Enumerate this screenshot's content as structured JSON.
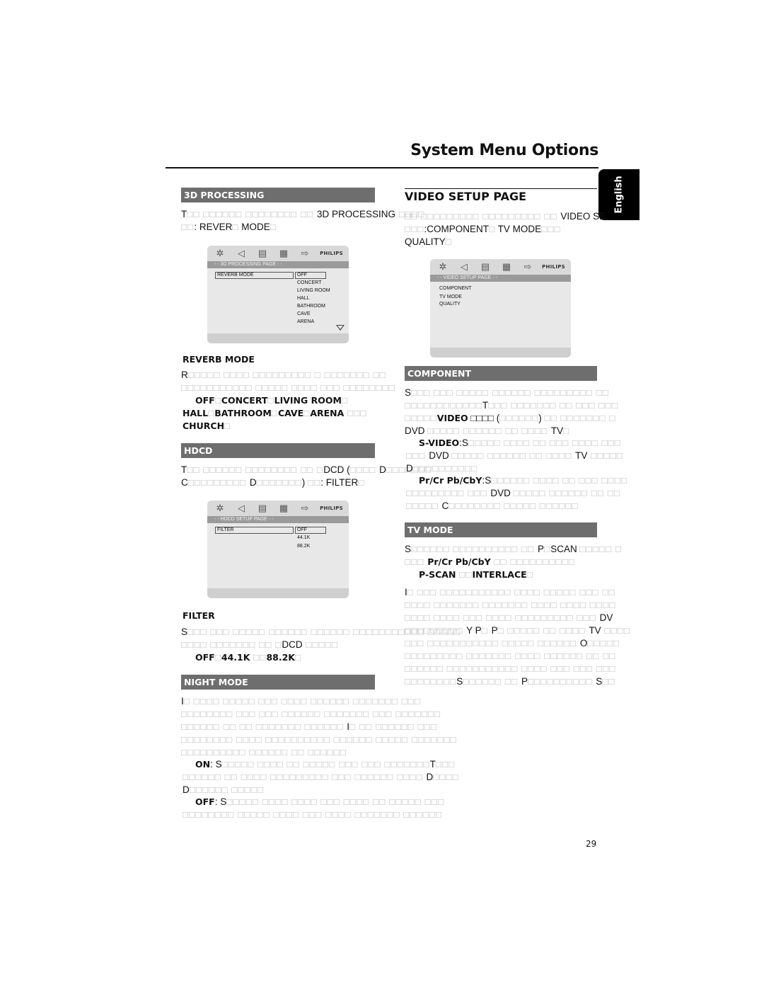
{
  "header": {
    "title": "System Menu Options",
    "language_tab": "English"
  },
  "left": {
    "processing": {
      "bar": "3D PROCESSING",
      "intro": [
        [
          [
            "T",
            ""
          ],
          [
            "□□ □□□□□□ □□□□□□□□ □□ ",
            "g"
          ],
          [
            "3D PROCESSING",
            ""
          ],
          [
            " □□□□",
            "g"
          ]
        ],
        [
          [
            "□□",
            "g"
          ],
          [
            ": REVER",
            ""
          ],
          [
            "□",
            "g"
          ],
          [
            " MODE",
            ""
          ],
          [
            "□",
            "g"
          ]
        ]
      ],
      "osd": {
        "brand": "PHILIPS",
        "title": "- -  3D PROCESSING PAGE  - -",
        "item": "REVERB MODE",
        "options": [
          "OFF",
          "CONCERT",
          "LIVING ROOM",
          "HALL",
          "BATHROOM",
          "CAVE",
          "ARENA"
        ],
        "selected": "OFF"
      },
      "reverb": {
        "heading": "REVERB MODE",
        "lines": [
          [
            [
              "R",
              ""
            ],
            [
              "□□□□□ □□□□ □□□□□□□□□ □ □□□□□□□ □□",
              "g"
            ]
          ],
          [
            [
              "□□□□□□□□□□□ □□□□□ □□□□ □□□ □□□□□□□□",
              "g"
            ]
          ]
        ],
        "options_lines": [
          [
            [
              "OFF",
              "b"
            ],
            [
              "□",
              "g"
            ],
            [
              "CONCERT",
              "b"
            ],
            [
              "□",
              "g"
            ],
            [
              "LIVING ROOM",
              "b"
            ],
            [
              "□",
              "g"
            ]
          ],
          [
            [
              "HALL",
              "b"
            ],
            [
              "□",
              "g"
            ],
            [
              "BATHROOM",
              "b"
            ],
            [
              "□",
              "g"
            ],
            [
              "CAVE",
              "b"
            ],
            [
              "□",
              "g"
            ],
            [
              "ARENA",
              "b"
            ],
            [
              " □□□",
              "g"
            ]
          ],
          [
            [
              "CHURCH",
              "b"
            ],
            [
              "□",
              "g"
            ]
          ]
        ]
      }
    },
    "hdcd": {
      "bar": "HDCD",
      "intro": [
        [
          [
            "T",
            ""
          ],
          [
            "□□ □□□□□□ □□□□□□□□ □□ □",
            "g"
          ],
          [
            "DCD (",
            ""
          ],
          [
            "□□□□ ",
            "g"
          ],
          [
            "D",
            ""
          ],
          [
            "□□□□□□□",
            "g"
          ]
        ],
        [
          [
            "C",
            ""
          ],
          [
            "□□□□□□□□□ ",
            "g"
          ],
          [
            "D",
            ""
          ],
          [
            "□□□□□□□",
            "g"
          ],
          [
            ") ",
            ""
          ],
          [
            "□□",
            "g"
          ],
          [
            ": FILTER",
            ""
          ],
          [
            "□",
            "g"
          ]
        ]
      ],
      "osd": {
        "brand": "PHILIPS",
        "title": "- -  HDCD SETUP PAGE  - -",
        "item": "FILTER",
        "options": [
          "OFF",
          "44.1K",
          "88.2K"
        ],
        "selected": "OFF"
      },
      "filter": {
        "heading": "FILTER",
        "lines": [
          [
            [
              "S",
              ""
            ],
            [
              "□□□ □□□ □□□□□ □□□□□□ □□□□□□ □□□□□□□□□□□ □□□□□",
              "g"
            ]
          ],
          [
            [
              "□□□□ □□□□□□□ □□ □",
              "g"
            ],
            [
              "DCD",
              ""
            ],
            [
              " □□□□□",
              "g"
            ]
          ]
        ],
        "options_line": [
          [
            "OFF",
            "b"
          ],
          [
            "□",
            "g"
          ],
          [
            "44.1K",
            "b"
          ],
          [
            " □□",
            "g"
          ],
          [
            "88.2K",
            "b"
          ],
          [
            "□",
            "g"
          ]
        ]
      }
    },
    "night": {
      "bar": "NIGHT MODE",
      "lines": [
        [
          [
            "I",
            ""
          ],
          [
            "□ □□□□ □□□□□ □□□ □□□□ □□□□□□ □□□□□□□ □□□",
            "g"
          ]
        ],
        [
          [
            "□□□□□□□□ □□□ □□□ □□□□□□ □□□□□□□ □□□ □□□□□□□",
            "g"
          ]
        ],
        [
          [
            "□□□□□□ □□ □□ □□□□□□□ □□□□□□ ",
            "g"
          ],
          [
            "I",
            ""
          ],
          [
            "□ □□ □□□□□□ □□□",
            "g"
          ]
        ],
        [
          [
            "□□□□□□□□ □□□□ □□□□□□□□□□ □□□□□□ □□□□□ □□□□□□□",
            "g"
          ]
        ],
        [
          [
            "□□□□□□□□□□ □□□□□□ □□ □□□□□□",
            "g"
          ]
        ]
      ],
      "on_lines": [
        [
          [
            "ON",
            "b"
          ],
          [
            ": S",
            ""
          ],
          [
            "□□□□□ □□□□ □□ □□□□□ □□□ □□□ □□□□□□□",
            "g"
          ],
          [
            "T",
            ""
          ],
          [
            "□□□",
            "g"
          ]
        ],
        [
          [
            "□□□□□□ □□ □□□□ □□□□□□□□□ □□□ □□□□□□ □□□□ ",
            "g"
          ],
          [
            "D",
            ""
          ],
          [
            "□□□□",
            "g"
          ]
        ],
        [
          [
            "D",
            ""
          ],
          [
            "□□□□□□ □□□□□",
            "g"
          ]
        ]
      ],
      "off_lines": [
        [
          [
            "OFF",
            "b"
          ],
          [
            ": S",
            ""
          ],
          [
            "□□□□□ □□□□ □□□□ □□□ □□□□ □□ □□□□□ □□□",
            "g"
          ]
        ],
        [
          [
            "□□□□□□□□ □□□□□ □□□□ □□□ □□□□ □□□□□□□ □□□□□□",
            "g"
          ]
        ]
      ]
    }
  },
  "right": {
    "video": {
      "heading": "VIDEO SETUP PAGE",
      "intro": [
        [
          [
            "□□ □□□□□□□□□ □□□□□□□□□ □□ ",
            "g"
          ],
          [
            "VIDEO SE",
            ""
          ]
        ],
        [
          [
            "□□□",
            "g"
          ],
          [
            ":COMPONENT",
            ""
          ],
          [
            "□",
            "g"
          ],
          [
            " TV MODE",
            ""
          ],
          [
            "□□□",
            "g"
          ]
        ],
        [
          [
            "QUALITY",
            ""
          ],
          [
            "□",
            "g"
          ]
        ]
      ],
      "osd": {
        "brand": "PHILIPS",
        "title": "- -  VIDEO SETUP PAGE  - -",
        "items": [
          "COMPONENT",
          "TV MODE",
          "QUALITY"
        ]
      }
    },
    "component": {
      "bar": "COMPONENT",
      "lines": [
        [
          [
            "S",
            ""
          ],
          [
            "□□□ □□□ □□□□□ □□□□□□ □□□□□□□□□ □□",
            "g"
          ]
        ],
        [
          [
            "□□□□□□□□□□□□",
            "g"
          ],
          [
            "T",
            ""
          ],
          [
            "□□□ □□□□□□□ □□ □□□ □□□",
            "g"
          ]
        ],
        [
          [
            "□□□□□",
            "g"
          ],
          [
            "VIDEO",
            "b"
          ],
          [
            " □□□□ (",
            ""
          ],
          [
            "□□□□□□",
            "g"
          ],
          [
            ") ",
            ""
          ],
          [
            "□□ □□□□□□□ □",
            "g"
          ]
        ],
        [
          [
            "DVD ",
            ""
          ],
          [
            "□□□□□ □□□□□□ □□ □□□□ ",
            "g"
          ],
          [
            "TV",
            ""
          ],
          [
            "□",
            "g"
          ]
        ]
      ],
      "svideo_lines": [
        [
          [
            "S-VIDEO",
            "b"
          ],
          [
            ":S",
            ""
          ],
          [
            "□□□□□ □□□□ □□ □□□ □□□□ □□□",
            "g"
          ]
        ],
        [
          [
            "□□□ ",
            "g"
          ],
          [
            "DVD ",
            ""
          ],
          [
            "□□□□□ □□□□□□ □□ □□□□ ",
            "g"
          ],
          [
            "TV",
            ""
          ],
          [
            " □□□□□",
            "g"
          ]
        ],
        [
          [
            "D",
            ""
          ],
          [
            "□□□□□□□□□□",
            "g"
          ]
        ]
      ],
      "ypbpr_lines": [
        [
          [
            "Pr/Cr Pb/CbY",
            "b"
          ],
          [
            ":S",
            ""
          ],
          [
            "□□□□□□ □□□□ □□ □□□ □□□□",
            "g"
          ]
        ],
        [
          [
            "□□□□□□□□□ □□□ ",
            "g"
          ],
          [
            "DVD ",
            ""
          ],
          [
            "□□□□□ □□□□□□ □□ □□",
            "g"
          ]
        ],
        [
          [
            "□□□□□ ",
            "g"
          ],
          [
            "C",
            ""
          ],
          [
            "□□□□□□□□ □□□□□ □□□□□□",
            "g"
          ]
        ]
      ]
    },
    "tvmode": {
      "bar": "TV MODE",
      "lines": [
        [
          [
            "S",
            ""
          ],
          [
            "□□□□□□ □□□□□□□□□□ □□ ",
            "g"
          ],
          [
            "P",
            ""
          ],
          [
            "□",
            "g"
          ],
          [
            "SCAN ",
            ""
          ],
          [
            "□□□□□ □",
            "g"
          ]
        ],
        [
          [
            "□□□ ",
            "g"
          ],
          [
            "Pr/Cr Pb/CbY",
            "b"
          ],
          [
            " □□ □□□□□□□□□□",
            "g"
          ]
        ]
      ],
      "options_line": [
        [
          "P-SCAN",
          "b"
        ],
        [
          " □□",
          "g"
        ],
        [
          "INTERLACE",
          "b"
        ],
        [
          "□",
          "g"
        ]
      ],
      "body_lines": [
        [
          [
            "I",
            ""
          ],
          [
            "□ □□□ □□□□□□□□□□□ □□□□ □□□□□ □□□ □□",
            "g"
          ]
        ],
        [
          [
            "□□□□ □□□□□□□ □□□□□□□ □□□□ □□□□ □□□□",
            "g"
          ]
        ],
        [
          [
            "□□□□ □□□□ □□□ □□□□ □□□□□□□□□ □□□ ",
            "g"
          ],
          [
            "DV",
            ""
          ]
        ],
        [
          [
            "□□□□□□□□□ ",
            "g"
          ],
          [
            "Y P",
            ""
          ],
          [
            "□ ",
            "g"
          ],
          [
            "P",
            ""
          ],
          [
            "□ □□□□□ □□ □□□□ ",
            "g"
          ],
          [
            "TV",
            ""
          ],
          [
            " □□□□",
            "g"
          ]
        ],
        [
          [
            "□□□ □□□□□□□□□□□ □□□□□ □□□□□□ ",
            "g"
          ],
          [
            "O",
            ""
          ],
          [
            "□□□□□",
            "g"
          ]
        ],
        [
          [
            "□□□□□□□□□ □□□□□□□ □□□□ □□□□□□ □□ □□",
            "g"
          ]
        ],
        [
          [
            "□□□□□□ □□□□□□□□□□□ □□□□ □□□ □□□ □□□",
            "g"
          ]
        ],
        [
          [
            "□□□□□□□□",
            "g"
          ],
          [
            "S",
            ""
          ],
          [
            "□□□□□□ □□ ",
            "g"
          ],
          [
            "P",
            ""
          ],
          [
            "□□□□□□□□□□ ",
            "g"
          ],
          [
            "S",
            ""
          ],
          [
            "□□",
            "g"
          ]
        ]
      ]
    }
  },
  "footer": {
    "page_number": "29"
  }
}
